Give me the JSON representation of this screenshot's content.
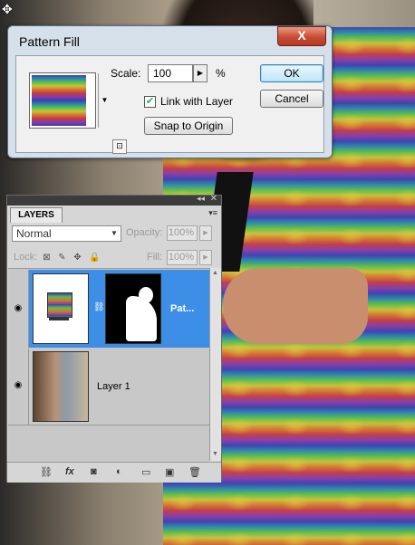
{
  "dialog": {
    "title": "Pattern Fill",
    "close_label": "X",
    "scale_label": "Scale:",
    "scale_value": "100",
    "percent_sign": "%",
    "link_with_layer_label": "Link with Layer",
    "link_with_layer_checked": true,
    "snap_to_origin_label": "Snap to Origin",
    "ok_label": "OK",
    "cancel_label": "Cancel"
  },
  "layers_panel": {
    "tab_label": "LAYERS",
    "blend_mode": "Normal",
    "opacity_label": "Opacity:",
    "opacity_value": "100%",
    "lock_label": "Lock:",
    "fill_label": "Fill:",
    "fill_value": "100%",
    "layers": [
      {
        "name": "Pat...",
        "selected": true,
        "visible": true
      },
      {
        "name": "Layer 1",
        "selected": false,
        "visible": true
      }
    ],
    "footer_icons": [
      "link-icon",
      "fx-icon",
      "mask-icon",
      "adjustment-icon",
      "group-folder-icon",
      "new-layer-icon",
      "trash-icon"
    ]
  }
}
